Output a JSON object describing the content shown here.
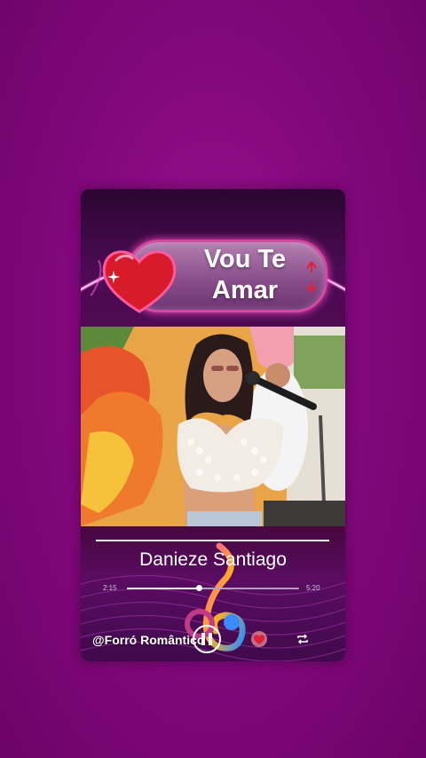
{
  "song": {
    "title": "Vou Te Amar",
    "title_line1": "Vou Te",
    "title_line2": "Amar",
    "artist": "Danieze Santiago"
  },
  "player": {
    "elapsed": "2:15",
    "duration": "5:20",
    "progress_fraction": 0.42
  },
  "channel": {
    "handle": "@Forró Romântico"
  },
  "icons": {
    "heart": "heart-icon",
    "pause": "pause-icon",
    "favorite": "heart-favorite-icon",
    "repeat": "repeat-icon",
    "music_note": "music-note-icon"
  },
  "colors": {
    "background": "#84087e",
    "neon_pink": "#ff4ec6",
    "heart_red": "#d81b2a",
    "banner": "#8a4f8c"
  }
}
